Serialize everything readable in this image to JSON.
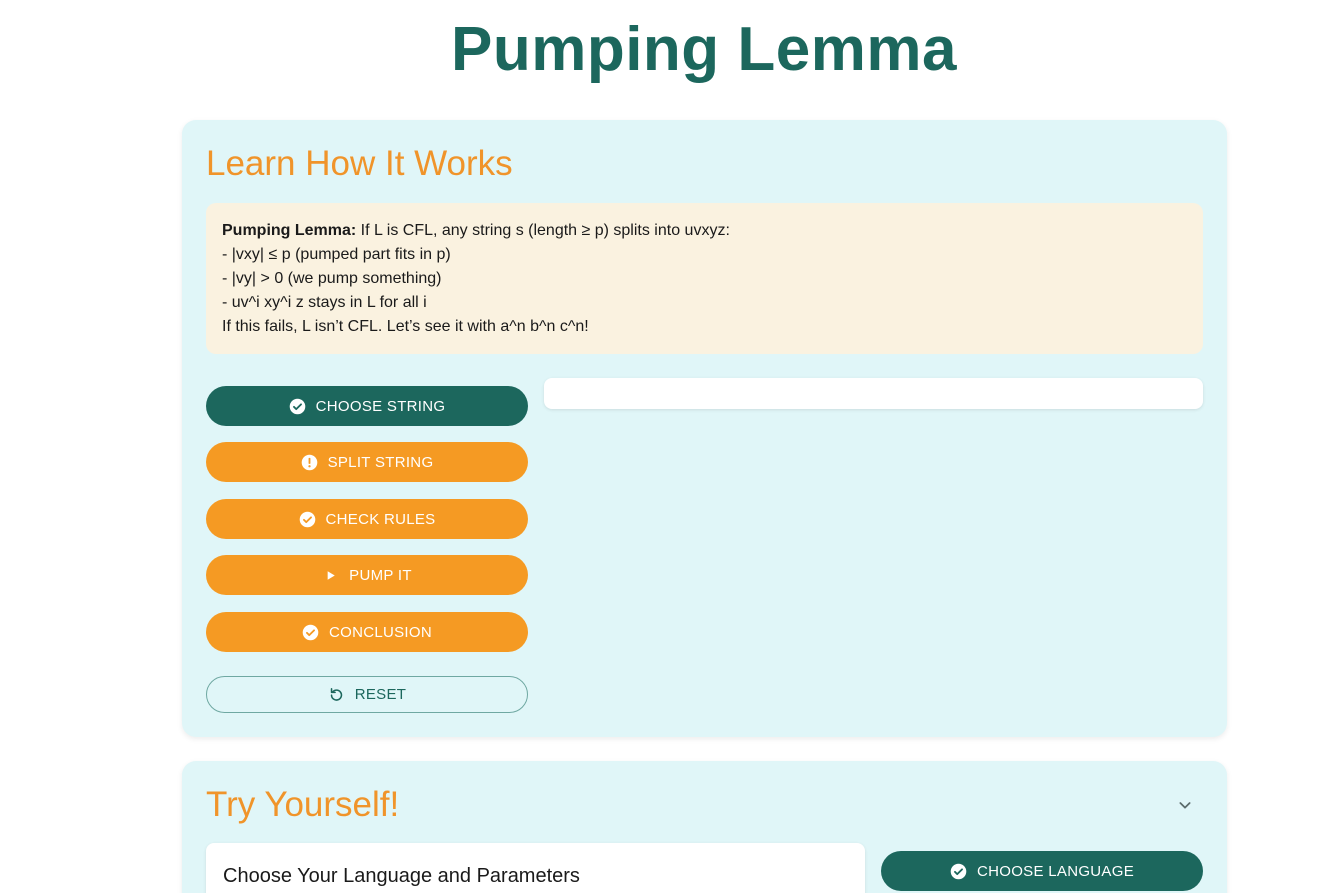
{
  "page": {
    "title": "Pumping Lemma"
  },
  "learn": {
    "heading": "Learn How It Works",
    "info": {
      "bold": "Pumping Lemma:",
      "line1": " If L is CFL, any string s (length ≥ p) splits into uvxyz:",
      "line2": "- |vxy| ≤ p (pumped part fits in p)",
      "line3": "- |vy| > 0 (we pump something)",
      "line4": "- uv^i xy^i z stays in L for all i",
      "line5": "If this fails, L isn’t CFL. Let’s see it with a^n b^n c^n!"
    },
    "steps": [
      {
        "label": "CHOOSE STRING",
        "icon": "check-circle-icon",
        "state": "active"
      },
      {
        "label": "SPLIT STRING",
        "icon": "alert-circle-icon",
        "state": "pending"
      },
      {
        "label": "CHECK RULES",
        "icon": "check-circle-icon",
        "state": "pending"
      },
      {
        "label": "PUMP IT",
        "icon": "play-icon",
        "state": "pending"
      },
      {
        "label": "CONCLUSION",
        "icon": "check-circle-icon",
        "state": "pending"
      }
    ],
    "reset": {
      "label": "RESET",
      "icon": "refresh-icon"
    }
  },
  "try": {
    "heading": "Try Yourself!",
    "panel_title": "Choose Your Language and Parameters",
    "choose_language": {
      "label": "CHOOSE LANGUAGE",
      "icon": "check-circle-icon"
    },
    "toggle_icon": "chevron-down-icon"
  },
  "colors": {
    "primary": "#1c675d",
    "accent": "#f59a23",
    "heading_orange": "#f0942a",
    "card_bg": "#e0f6f8",
    "info_bg": "#faf2e0"
  }
}
